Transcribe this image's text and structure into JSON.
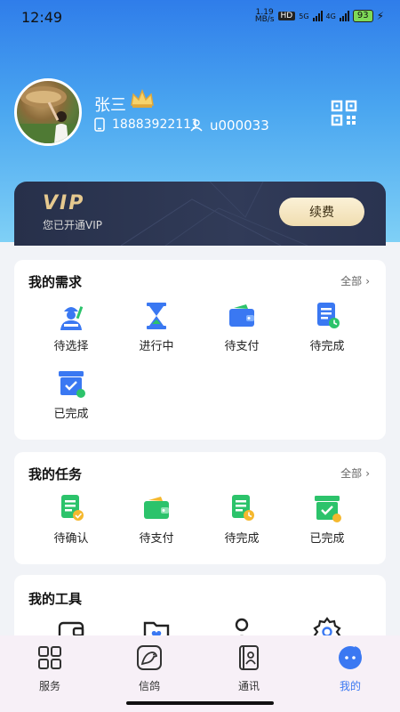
{
  "status": {
    "time": "12:49",
    "net_speed_top": "1.19",
    "net_speed_unit": "MB/s",
    "hd": "HD",
    "sig1": "5G",
    "sig2": "4G",
    "battery": "93"
  },
  "profile": {
    "name": "张三",
    "phone": "18883922111",
    "uid": "u000033"
  },
  "vip": {
    "title": "VIP",
    "subtitle": "您已开通VIP",
    "renew_label": "续费"
  },
  "demands": {
    "title": "我的需求",
    "more": "全部",
    "items": [
      {
        "label": "待选择",
        "icon": "worker-icon"
      },
      {
        "label": "进行中",
        "icon": "hourglass-icon"
      },
      {
        "label": "待支付",
        "icon": "wallet-icon"
      },
      {
        "label": "待完成",
        "icon": "document-clock-icon"
      },
      {
        "label": "已完成",
        "icon": "box-check-icon"
      }
    ]
  },
  "tasks": {
    "title": "我的任务",
    "more": "全部",
    "items": [
      {
        "label": "待确认",
        "icon": "document-check-icon"
      },
      {
        "label": "待支付",
        "icon": "wallet-icon"
      },
      {
        "label": "待完成",
        "icon": "document-clock-icon"
      },
      {
        "label": "已完成",
        "icon": "box-check-icon"
      }
    ]
  },
  "tools": {
    "title": "我的工具",
    "items": [
      {
        "icon": "wallet-outline-icon"
      },
      {
        "icon": "folder-heart-icon"
      },
      {
        "icon": "user-outline-icon"
      },
      {
        "icon": "settings-icon"
      }
    ]
  },
  "tabbar": {
    "items": [
      {
        "label": "服务",
        "icon": "grid-icon"
      },
      {
        "label": "信鸽",
        "icon": "pigeon-icon"
      },
      {
        "label": "通讯",
        "icon": "contacts-icon"
      },
      {
        "label": "我的",
        "icon": "profile-bubble-icon"
      }
    ],
    "active_index": 3
  },
  "colors": {
    "accent": "#3a78f2",
    "green": "#2cc36b",
    "vip_gold": "#e6c98f"
  }
}
